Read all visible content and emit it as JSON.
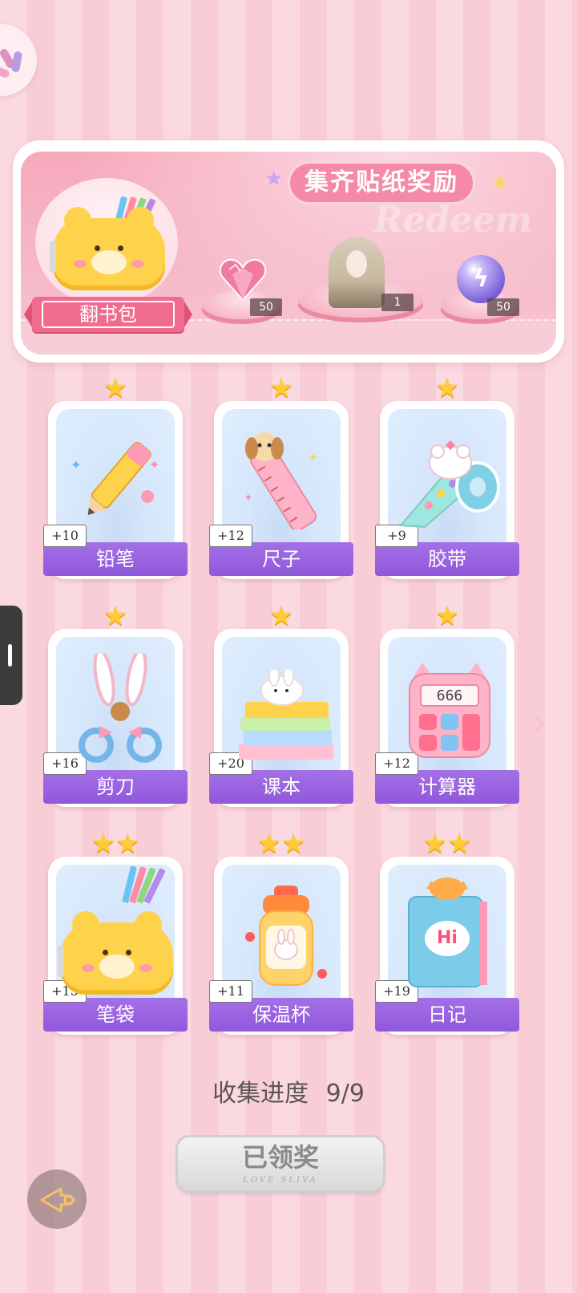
{
  "banner": {
    "title": "集齐贴纸奖励",
    "watermark": "Redeem",
    "bag_label": "翻书包",
    "rewards": [
      {
        "name": "heart-gem",
        "qty": "50"
      },
      {
        "name": "character-portrait",
        "qty": "1"
      },
      {
        "name": "energy-orb",
        "qty": "50"
      }
    ]
  },
  "stickers": [
    {
      "label": "铅笔",
      "bonus": "+10",
      "stars": 1
    },
    {
      "label": "尺子",
      "bonus": "+12",
      "stars": 1
    },
    {
      "label": "胶带",
      "bonus": "+9",
      "stars": 1
    },
    {
      "label": "剪刀",
      "bonus": "+16",
      "stars": 1
    },
    {
      "label": "课本",
      "bonus": "+20",
      "stars": 1
    },
    {
      "label": "计算器",
      "bonus": "+12",
      "stars": 1
    },
    {
      "label": "笔袋",
      "bonus": "+15",
      "stars": 2
    },
    {
      "label": "保温杯",
      "bonus": "+11",
      "stars": 2
    },
    {
      "label": "日记",
      "bonus": "+19",
      "stars": 2
    }
  ],
  "calculator_display": "666",
  "diary_text": "Hi",
  "progress": {
    "label": "收集进度",
    "value": "9/9"
  },
  "claim_button": {
    "label": "已领奖",
    "sub": "LOVE SLIVA"
  },
  "colors": {
    "accent": "#9058db",
    "star": "#ffcc33",
    "banner": "#f58aa6"
  }
}
